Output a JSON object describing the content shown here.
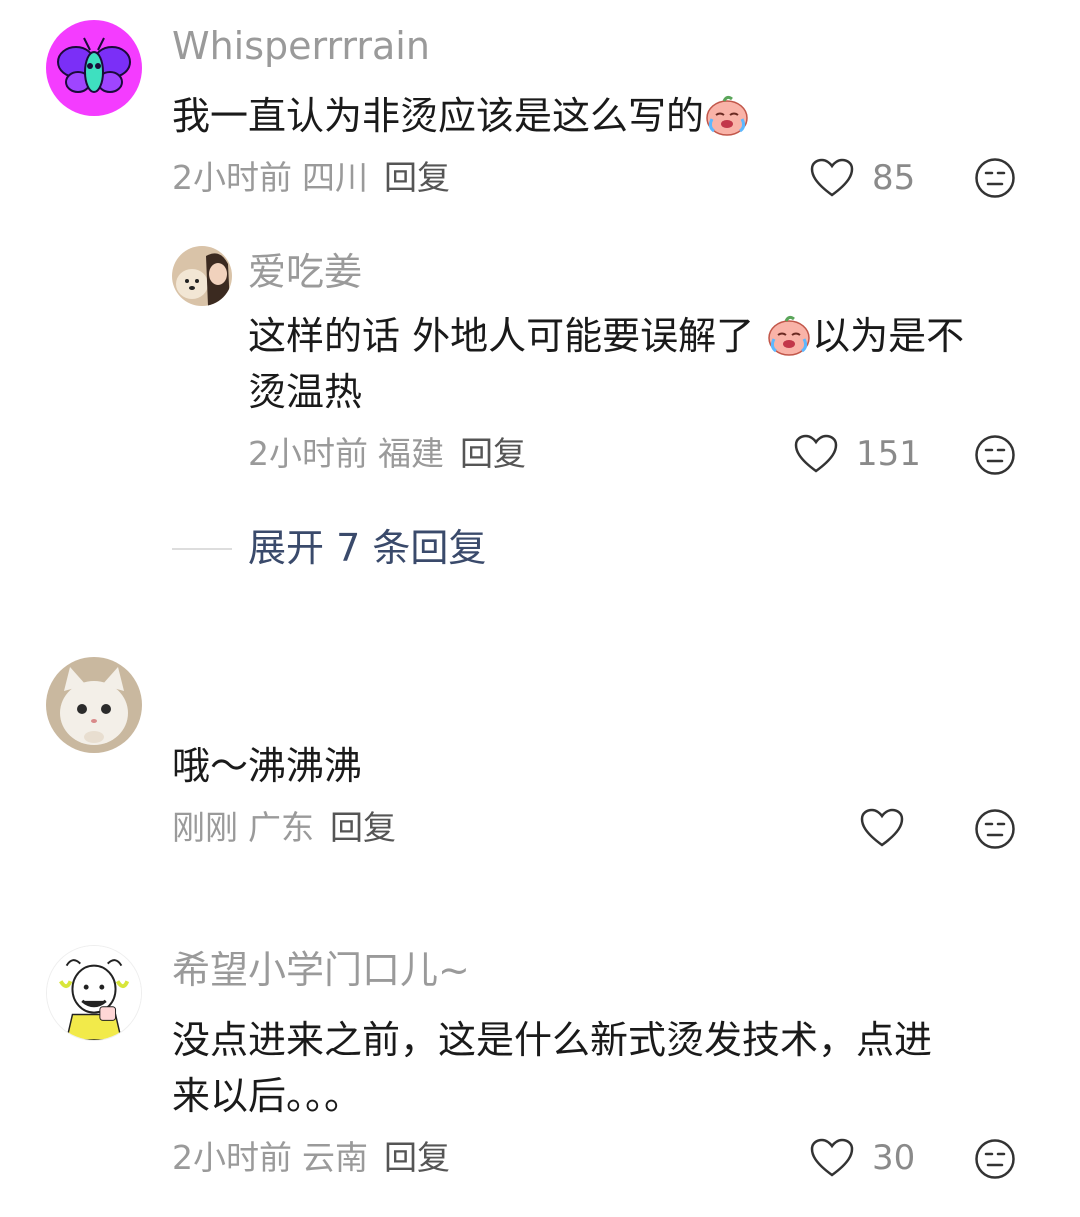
{
  "comments": [
    {
      "username": "Whisperrrrain",
      "text": "我一直认为非烫应该是这么写的",
      "time": "2小时前",
      "location": "四川",
      "reply_label": "回复",
      "likes": "85",
      "avatar_icon": "purple-butterfly-avatar",
      "text_emoji": "crying-peach-emoji"
    },
    {
      "username": "爱吃姜",
      "text_line1": "这样的话 外地人可能要误解了 ",
      "text_line1_after": "以为是不",
      "text_line2": "烫温热",
      "time": "2小时前",
      "location": "福建",
      "reply_label": "回复",
      "likes": "151",
      "avatar_icon": "woman-with-dog-avatar",
      "text_emoji": "crying-peach-emoji"
    },
    {
      "username": "",
      "text": "哦～沸沸沸",
      "time": "刚刚",
      "location": "广东",
      "reply_label": "回复",
      "likes": "",
      "avatar_icon": "white-kitten-avatar"
    },
    {
      "username": "希望小学门口儿~",
      "text_line1": "没点进来之前，这是什么新式烫发技术，点进",
      "text_line2": "来以后。。。",
      "time": "2小时前",
      "location": "云南",
      "reply_label": "回复",
      "likes": "30",
      "avatar_icon": "cartoon-character-avatar"
    }
  ],
  "expand_replies": "展开 7 条回复",
  "colors": {
    "muted": "#9a9a9a",
    "text": "#1a1a1a",
    "link": "#3a4a6b",
    "avatar_pink": "#f43cff"
  }
}
